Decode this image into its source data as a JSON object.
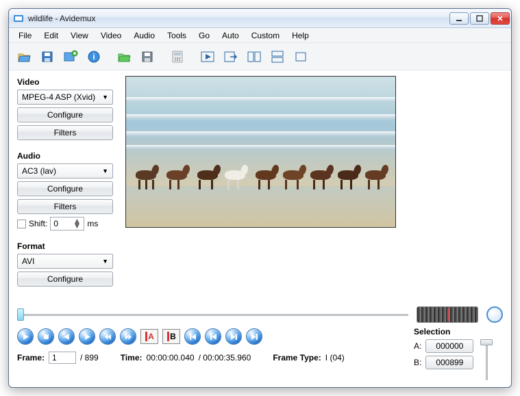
{
  "titlebar": {
    "title": "wildlife - Avidemux"
  },
  "menubar": {
    "items": [
      "File",
      "Edit",
      "View",
      "Video",
      "Audio",
      "Tools",
      "Go",
      "Auto",
      "Custom",
      "Help"
    ]
  },
  "video": {
    "label": "Video",
    "codec": "MPEG-4 ASP (Xvid)",
    "configure": "Configure",
    "filters": "Filters"
  },
  "audio": {
    "label": "Audio",
    "codec": "AC3 (lav)",
    "configure": "Configure",
    "filters": "Filters",
    "shift_label": "Shift:",
    "shift_value": "0",
    "shift_unit": "ms"
  },
  "format": {
    "label": "Format",
    "container": "AVI",
    "configure": "Configure"
  },
  "selection": {
    "title": "Selection",
    "a_label": "A:",
    "a_value": "000000",
    "b_label": "B:",
    "b_value": "000899"
  },
  "status": {
    "frame_label": "Frame:",
    "frame_value": "1",
    "frame_total": "/ 899",
    "time_label": "Time:",
    "time_value": "00:00:00.040",
    "time_total": "/ 00:00:35.960",
    "frametype_label": "Frame Type:",
    "frametype_value": "I (04)"
  },
  "ab": {
    "a": "A",
    "b": "B"
  }
}
